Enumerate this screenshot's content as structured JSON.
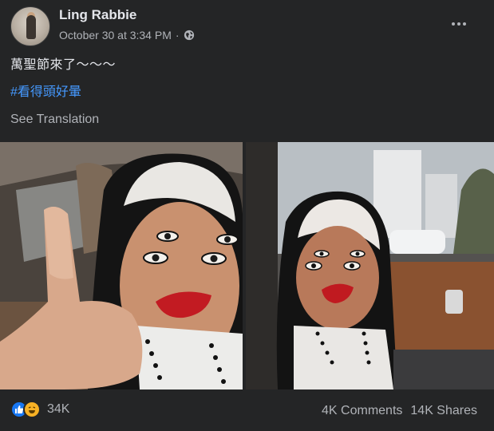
{
  "post": {
    "author": "Ling Rabbie",
    "timestamp": "October 30 at 3:34 PM",
    "separator": "·",
    "privacy_icon": "globe-icon",
    "more_icon": "more-horizontal-icon",
    "text": "萬聖節來了～～～",
    "hashtag": "#看得頭好暈",
    "see_translation": "See Translation"
  },
  "photos": [
    {
      "icon": "photo-left"
    },
    {
      "icon": "photo-right"
    }
  ],
  "footer": {
    "reaction_icons": [
      "like-icon",
      "haha-icon"
    ],
    "reaction_count": "34K",
    "comments": "4K Comments",
    "shares": "14K Shares"
  },
  "colors": {
    "background": "#242526",
    "text": "#e4e6eb",
    "secondary_text": "#b0b3b8",
    "link": "#4599ff",
    "like": "#1877f2",
    "haha": "#f7b125"
  }
}
